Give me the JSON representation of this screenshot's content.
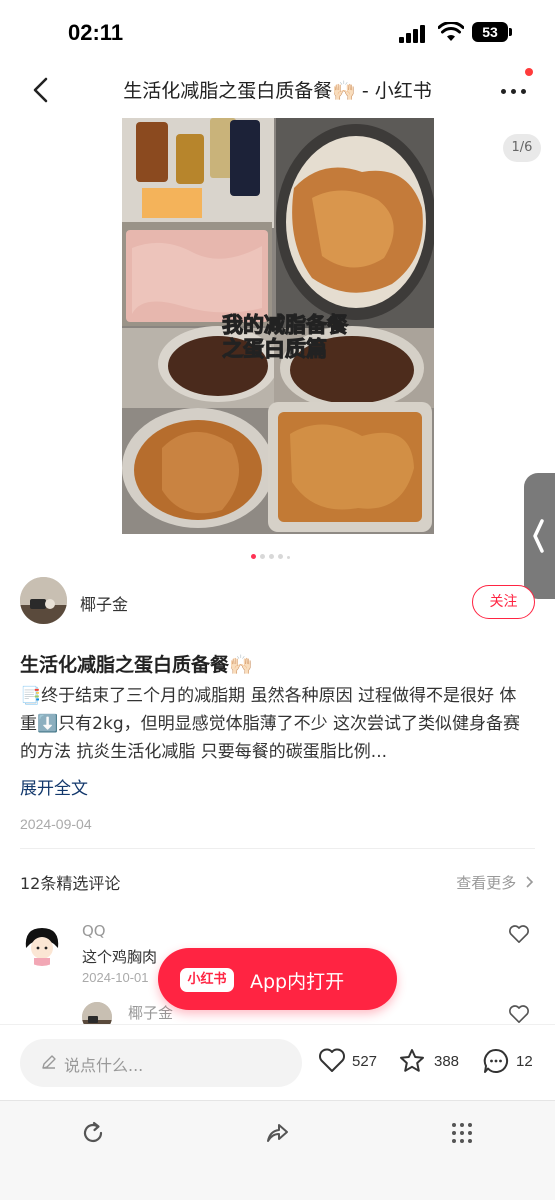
{
  "status_bar": {
    "time": "02:11",
    "battery": "53"
  },
  "nav": {
    "title": "生活化减脂之蛋白质备餐🙌🏻 - 小红书"
  },
  "carousel": {
    "counter": "1/6",
    "overlay_line1": "我的减脂备餐",
    "overlay_line2": "之蛋白质篇",
    "slide_count": 6,
    "active_slide": 1
  },
  "author": {
    "name": "椰子金",
    "follow_label": "关注"
  },
  "note": {
    "title": "生活化减脂之蛋白质备餐🙌🏻",
    "text": "📑终于结束了三个月的减脂期 虽然各种原因 过程做得不是很好 体重⬇️只有2kg，但明显感觉体脂薄了不少 这次尝试了类似健身备赛的方法 抗炎生活化减脂 只要每餐的碳蛋脂比例...",
    "expand_label": "展开全文",
    "date": "2024-09-04"
  },
  "comments": {
    "header": "12条精选评论",
    "see_more": "查看更多",
    "items": [
      {
        "name": "QQ",
        "text": "这个鸡胸肉",
        "date": "2024-10-01"
      },
      {
        "name": "椰子金",
        "text": "",
        "date": ""
      }
    ]
  },
  "open_app": {
    "logo": "小红书",
    "label": "App内打开"
  },
  "bottom_bar": {
    "placeholder": "说点什么...",
    "likes": "527",
    "collects": "388",
    "comments": "12"
  },
  "colors": {
    "accent": "#ff2442",
    "link": "#13386c"
  }
}
